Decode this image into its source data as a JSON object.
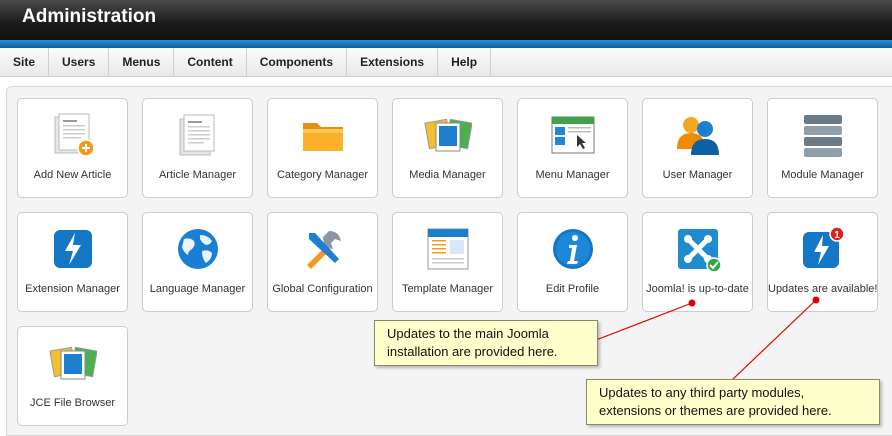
{
  "header": {
    "title": "Administration"
  },
  "menu": [
    "Site",
    "Users",
    "Menus",
    "Content",
    "Components",
    "Extensions",
    "Help"
  ],
  "tiles": [
    {
      "label": "Add New Article",
      "icon": "add-article-icon"
    },
    {
      "label": "Article Manager",
      "icon": "article-icon"
    },
    {
      "label": "Category Manager",
      "icon": "folder-icon"
    },
    {
      "label": "Media Manager",
      "icon": "media-icon"
    },
    {
      "label": "Menu Manager",
      "icon": "menu-icon"
    },
    {
      "label": "User Manager",
      "icon": "users-icon"
    },
    {
      "label": "Module Manager",
      "icon": "module-icon"
    },
    {
      "label": "Extension Manager",
      "icon": "extension-icon"
    },
    {
      "label": "Language Manager",
      "icon": "globe-icon"
    },
    {
      "label": "Global Configuration",
      "icon": "tools-icon"
    },
    {
      "label": "Template Manager",
      "icon": "template-icon"
    },
    {
      "label": "Edit Profile",
      "icon": "info-icon"
    },
    {
      "label": "Joomla! is up-to-date",
      "icon": "joomla-icon"
    },
    {
      "label": "Updates are available!",
      "icon": "update-icon",
      "badge": "1"
    },
    {
      "label": "JCE File Browser",
      "icon": "file-browser-icon"
    }
  ],
  "callouts": {
    "joomla": "Updates to the main Joomla installation are provided here.",
    "third_party": "Updates to any third party modules, extensions or themes are provided here."
  },
  "colors": {
    "accent_blue": "#1874bd",
    "callout_bg": "#ffffcc",
    "annotation_red": "#e00000"
  }
}
